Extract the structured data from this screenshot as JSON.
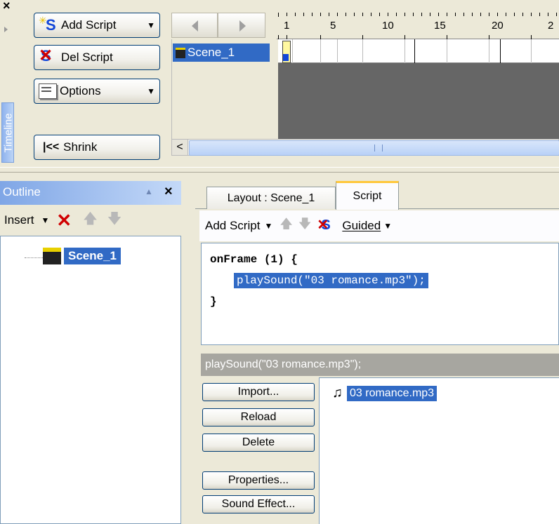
{
  "timeline": {
    "label": "Timeline",
    "buttons": {
      "add_script": "Add Script",
      "del_script": "Del Script",
      "options": "Options",
      "shrink": "Shrink"
    },
    "scene_name": "Scene_1",
    "ruler_ticks": [
      "1",
      "5",
      "10",
      "15",
      "20",
      "2"
    ]
  },
  "outline": {
    "title": "Outline",
    "insert_label": "Insert",
    "tree_item": "Scene_1"
  },
  "editor": {
    "tabs": [
      "Layout : Scene_1",
      "Script"
    ],
    "active_tab": "Script",
    "toolbar": {
      "add_script": "Add Script",
      "guided": "Guided"
    },
    "code": {
      "line1": "onFrame (1) {",
      "line2": "playSound(\"03 romance.mp3\");",
      "line3": "}"
    },
    "status_line": "playSound(\"03 romance.mp3\");"
  },
  "sounds": {
    "buttons": {
      "import": "Import...",
      "reload": "Reload",
      "delete": "Delete",
      "properties": "Properties...",
      "sound_effect": "Sound Effect..."
    },
    "files": [
      "03 romance.mp3"
    ]
  },
  "colors": {
    "selection": "#316ac5",
    "panel": "#ece9d8",
    "timeline_gray": "#666666"
  }
}
